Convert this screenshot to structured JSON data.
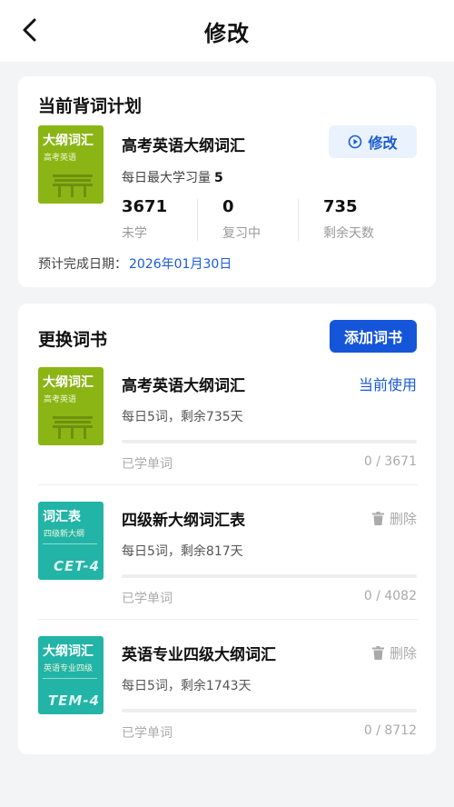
{
  "header": {
    "title": "修改",
    "back_icon": "chevron-left-icon"
  },
  "plan": {
    "section_title": "当前背词计划",
    "cover": {
      "title": "大纲词汇",
      "subtitle": "高考英语",
      "color": "#8bb514"
    },
    "book_name": "高考英语大纲词汇",
    "modify_label": "修改",
    "modify_icon": "play-circle-icon",
    "daily_label": "每日最大学习量",
    "daily_value": "5",
    "stats": [
      {
        "value": "3671",
        "label": "未学"
      },
      {
        "value": "0",
        "label": "复习中"
      },
      {
        "value": "735",
        "label": "剩余天数"
      }
    ],
    "finish_label": "预计完成日期：",
    "finish_date": "2026年01月30日"
  },
  "books": {
    "section_title": "更换词书",
    "add_label": "添加词书",
    "items": [
      {
        "cover": {
          "title": "大纲词汇",
          "subtitle": "高考英语",
          "tag": "",
          "color": "#8bb514"
        },
        "name": "高考英语大纲词汇",
        "meta": "每日5词，剩余735天",
        "action": "当前使用",
        "learned_label": "已学单词",
        "count": "0 / 3671",
        "progress": 0
      },
      {
        "cover": {
          "title": "词汇表",
          "subtitle": "四级新大纲",
          "tag": "CET-4",
          "color": "#22b4a6"
        },
        "name": "四级新大纲词汇表",
        "meta": "每日5词，剩余817天",
        "action": "删除",
        "learned_label": "已学单词",
        "count": "0 / 4082",
        "progress": 0
      },
      {
        "cover": {
          "title": "大纲词汇",
          "subtitle": "英语专业四级",
          "tag": "TEM-4",
          "color": "#22b4a6"
        },
        "name": "英语专业四级大纲词汇",
        "meta": "每日5词，剩余1743天",
        "action": "删除",
        "learned_label": "已学单词",
        "count": "0 / 8712",
        "progress": 0
      }
    ]
  },
  "colors": {
    "accent": "#1555d9",
    "link": "#1a5bd6",
    "cover_green": "#8bb514",
    "cover_teal": "#22b4a6"
  }
}
